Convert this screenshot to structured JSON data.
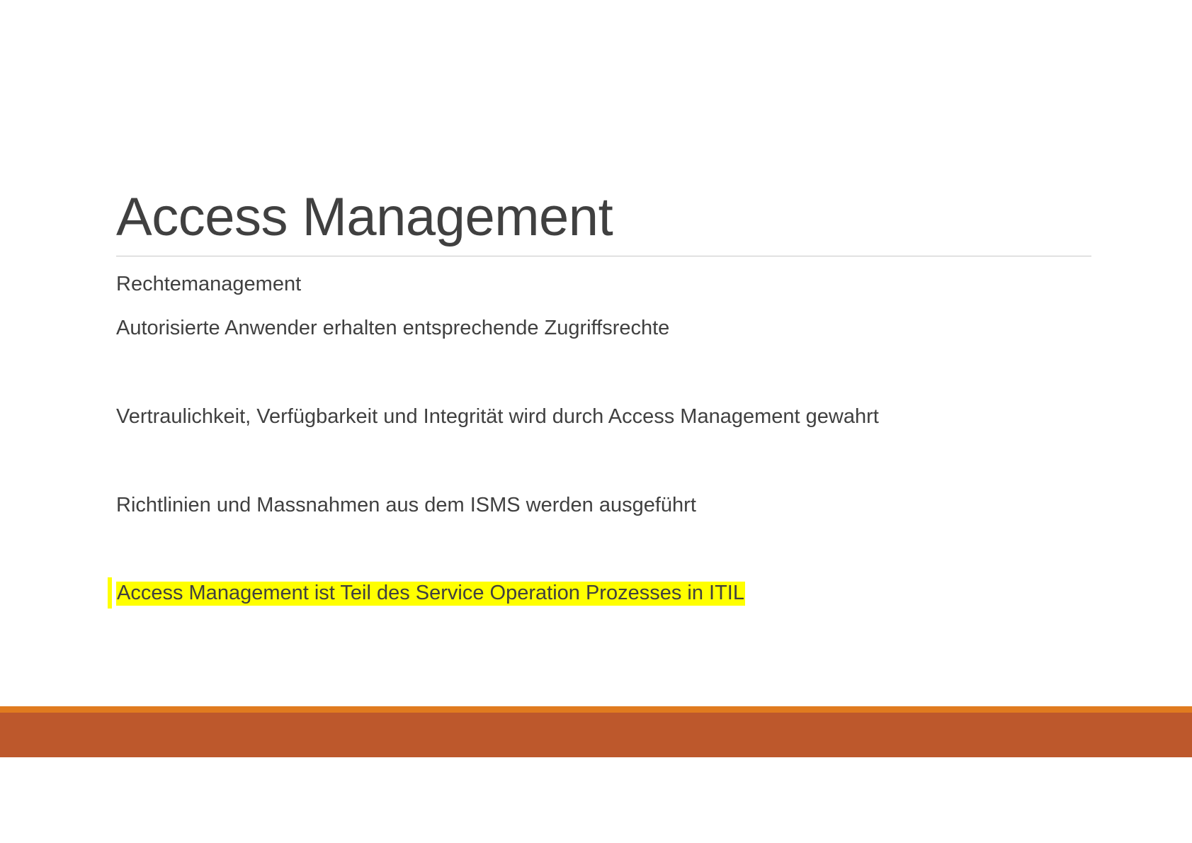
{
  "slide": {
    "title": "Access Management",
    "bullets": [
      "Rechtemanagement",
      "Autorisierte Anwender erhalten entsprechende Zugriffsrechte",
      "Vertraulichkeit, Verfügbarkeit und Integrität wird durch Access Management gewahrt",
      "Richtlinien und Massnahmen aus dem ISMS werden ausgeführt",
      "Access Management ist Teil des Service Operation Prozesses in ITIL"
    ]
  },
  "colors": {
    "highlight": "#ffff00",
    "footer_accent": "#e07b1f",
    "footer_band": "#bd582c",
    "text": "#404040"
  }
}
